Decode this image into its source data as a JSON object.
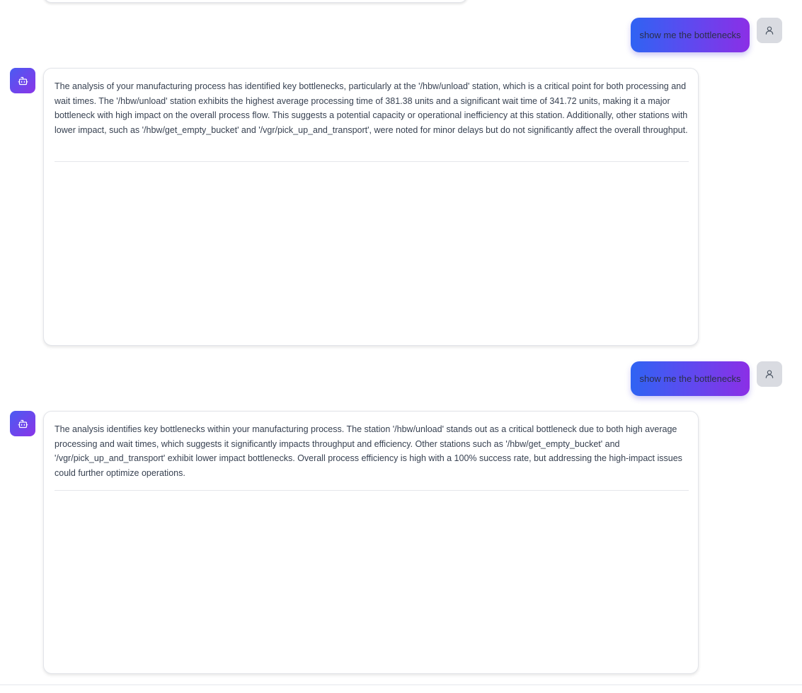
{
  "conversation": {
    "messages": [
      {
        "role": "user",
        "text": "show me the bottlenecks"
      },
      {
        "role": "assistant",
        "text": "The analysis of your manufacturing process has identified key bottlenecks, particularly at the '/hbw/unload' station, which is a critical point for both processing and wait times. The '/hbw/unload' station exhibits the highest average processing time of 381.38 units and a significant wait time of 341.72 units, making it a major bottleneck with high impact on the overall process flow. This suggests a potential capacity or operational inefficiency at this station. Additionally, other stations with lower impact, such as '/hbw/get_empty_bucket' and '/vgr/pick_up_and_transport', were noted for minor delays but do not significantly affect the overall throughput."
      },
      {
        "role": "user",
        "text": "show me the bottlenecks"
      },
      {
        "role": "assistant",
        "text": "The analysis identifies key bottlenecks within your manufacturing process. The station '/hbw/unload' stands out as a critical bottleneck due to both high average processing and wait times, which suggests it significantly impacts throughput and efficiency. Other stations such as '/hbw/get_empty_bucket' and '/vgr/pick_up_and_transport' exhibit lower impact bottlenecks. Overall process efficiency is high with a 100% success rate, but addressing the high-impact issues could further optimize operations."
      }
    ]
  },
  "icons": {
    "user_avatar": "user-icon",
    "bot_avatar": "bot-icon"
  },
  "colors": {
    "user_bubble_start": "#2f63f3",
    "user_bubble_end": "#8b2fe6",
    "bot_avatar_start": "#4a5bf2",
    "bot_avatar_end": "#8a35e8",
    "user_avatar_bg": "#d9dbe1",
    "body_text": "#374151"
  }
}
